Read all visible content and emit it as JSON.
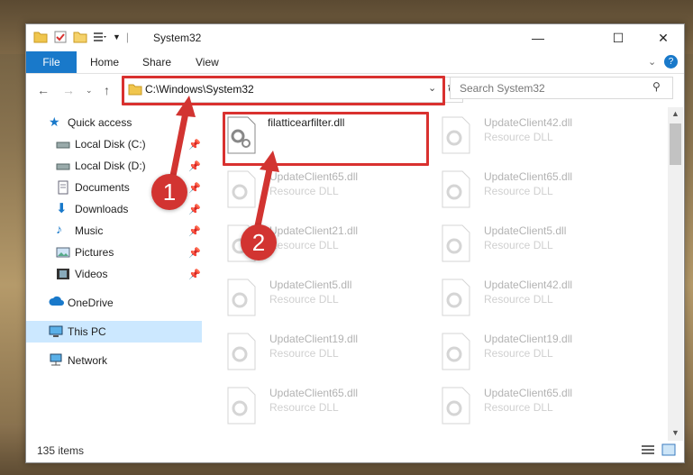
{
  "titlebar": {
    "title": "System32",
    "minimize_icon": "minimize-icon",
    "maximize_icon": "maximize-icon",
    "close_icon": "close-icon"
  },
  "ribbon": {
    "tabs": [
      "File",
      "Home",
      "Share",
      "View"
    ],
    "help_icon": "help-icon"
  },
  "addressbar": {
    "path": "C:\\Windows\\System32",
    "search_placeholder": "Search System32"
  },
  "sidebar": {
    "items": [
      {
        "label": "Quick access",
        "icon": "star-icon",
        "pinned": false
      },
      {
        "label": "Local Disk (C:)",
        "icon": "drive-icon",
        "pinned": true
      },
      {
        "label": "Local Disk (D:)",
        "icon": "drive-icon",
        "pinned": true
      },
      {
        "label": "Documents",
        "icon": "document-icon",
        "pinned": true
      },
      {
        "label": "Downloads",
        "icon": "download-icon",
        "pinned": true
      },
      {
        "label": "Music",
        "icon": "music-icon",
        "pinned": true
      },
      {
        "label": "Pictures",
        "icon": "pictures-icon",
        "pinned": true
      },
      {
        "label": "Videos",
        "icon": "videos-icon",
        "pinned": true
      },
      {
        "label": "OneDrive",
        "icon": "cloud-icon",
        "pinned": false
      },
      {
        "label": "This PC",
        "icon": "computer-icon",
        "pinned": false
      },
      {
        "label": "Network",
        "icon": "network-icon",
        "pinned": false
      }
    ]
  },
  "files": [
    {
      "name": "filatticearfilter.dll",
      "type": ""
    },
    {
      "name": "UpdateClient42.dll",
      "type": "Resource DLL"
    },
    {
      "name": "UpdateClient65.dll",
      "type": "Resource DLL"
    },
    {
      "name": "UpdateClient65.dll",
      "type": "Resource DLL"
    },
    {
      "name": "UpdateClient21.dll",
      "type": "Resource DLL"
    },
    {
      "name": "UpdateClient5.dll",
      "type": "Resource DLL"
    },
    {
      "name": "UpdateClient5.dll",
      "type": "Resource DLL"
    },
    {
      "name": "UpdateClient42.dll",
      "type": "Resource DLL"
    },
    {
      "name": "UpdateClient19.dll",
      "type": "Resource DLL"
    },
    {
      "name": "UpdateClient19.dll",
      "type": "Resource DLL"
    },
    {
      "name": "UpdateClient65.dll",
      "type": "Resource DLL"
    },
    {
      "name": "UpdateClient65.dll",
      "type": "Resource DLL"
    }
  ],
  "status": {
    "item_count": "135 items"
  },
  "markers": [
    "1",
    "2"
  ],
  "colors": {
    "accent": "#1979ca",
    "highlight": "#d9312f",
    "selected": "#cce8ff"
  }
}
